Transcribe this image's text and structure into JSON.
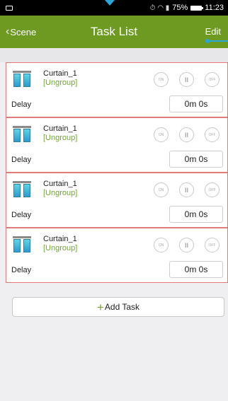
{
  "status_bar": {
    "time": "11:23",
    "battery": "75%",
    "icons": "⏱ ≡ \u0001"
  },
  "header": {
    "back_label": "Scene",
    "title": "Task List",
    "edit_label": "Edit",
    "color": "#6e9a22"
  },
  "tasks": [
    {
      "name": "Curtain_1",
      "group": "[Ungroup]",
      "on": "ON",
      "pause": "II",
      "off": "OFF",
      "delay_label": "Delay",
      "delay_value": "0m 0s"
    },
    {
      "name": "Curtain_1",
      "group": "[Ungroup]",
      "on": "ON",
      "pause": "II",
      "off": "OFF",
      "delay_label": "Delay",
      "delay_value": "0m 0s"
    },
    {
      "name": "Curtain_1",
      "group": "[Ungroup]",
      "on": "ON",
      "pause": "II",
      "off": "OFF",
      "delay_label": "Delay",
      "delay_value": "0m 0s"
    },
    {
      "name": "Curtain_1",
      "group": "[Ungroup]",
      "on": "ON",
      "pause": "II",
      "off": "OFF",
      "delay_label": "Delay",
      "delay_value": "0m 0s"
    }
  ],
  "add_task": {
    "icon": "+",
    "label": "Add Task"
  },
  "colors": {
    "accent": "#6e9a22",
    "card_border": "#e27a7a",
    "group_text": "#6fa92e"
  }
}
